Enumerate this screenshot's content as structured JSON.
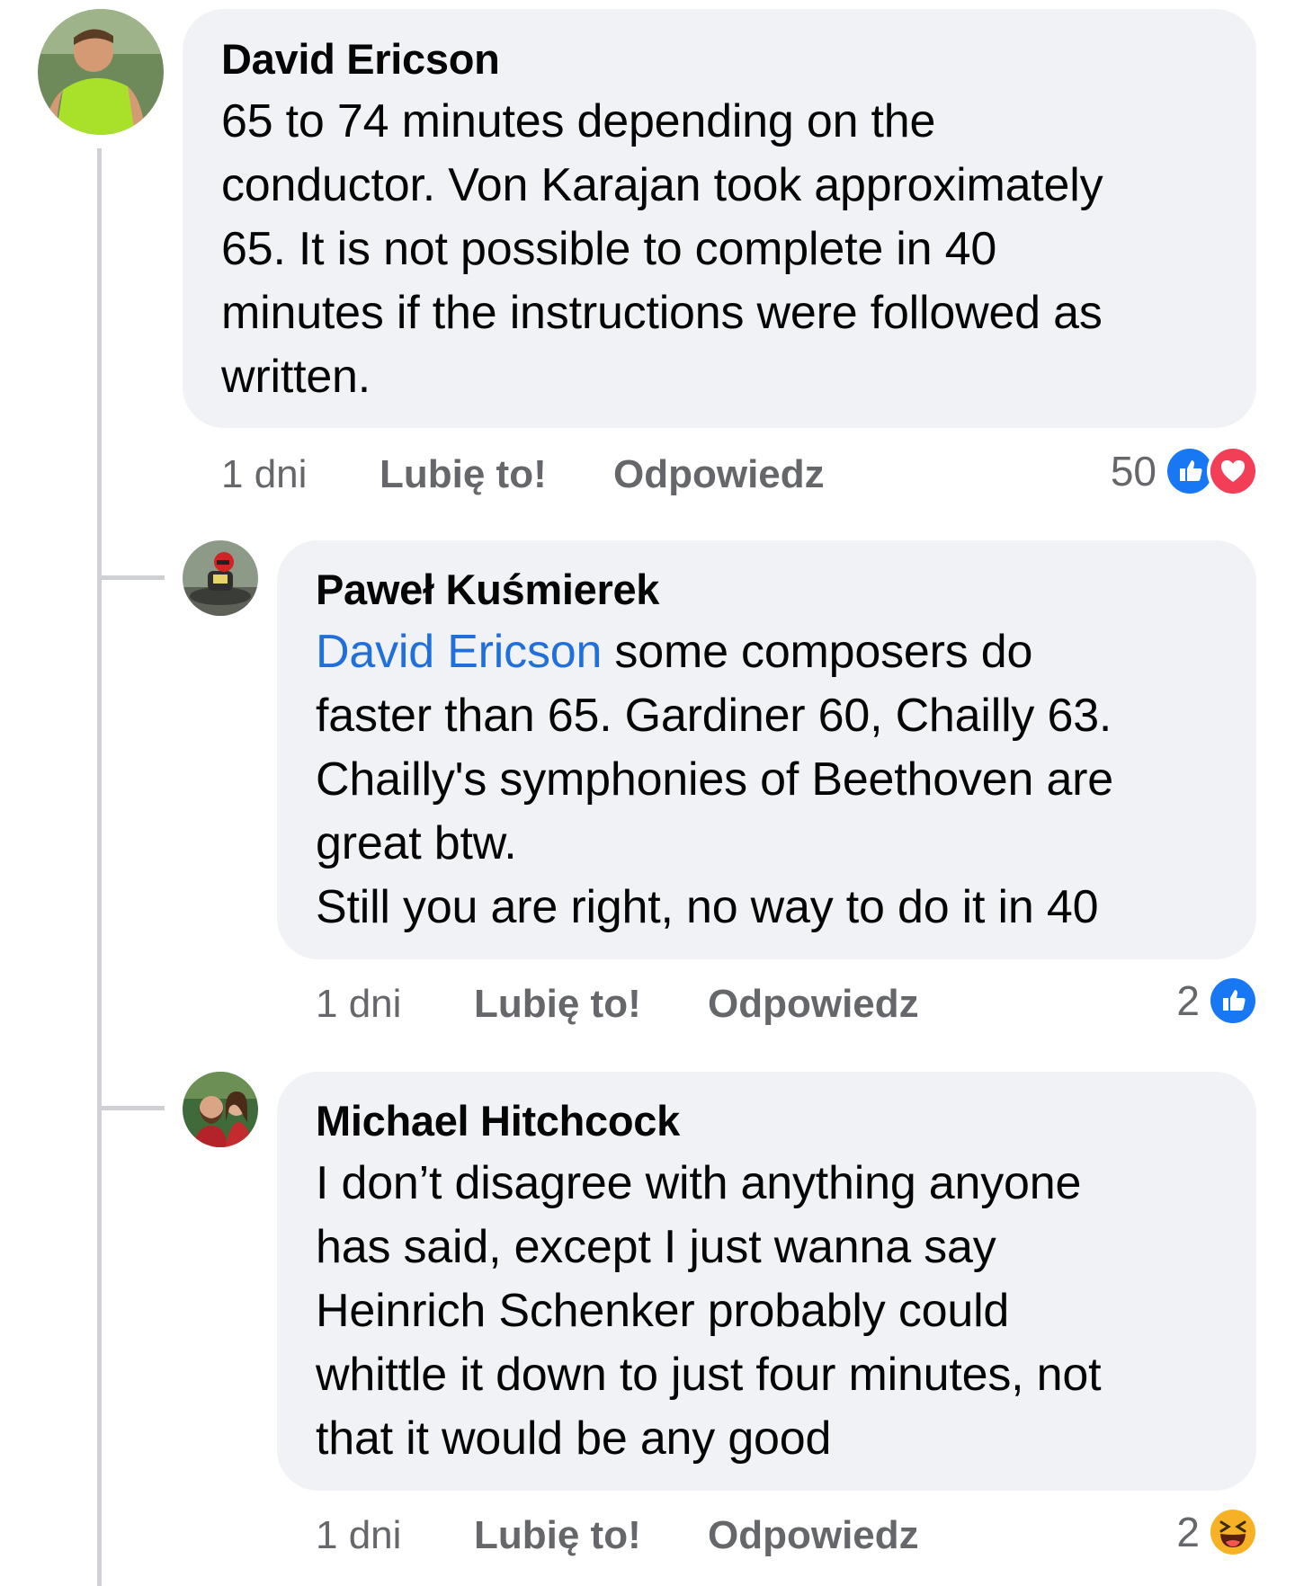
{
  "comments": [
    {
      "author": "David Ericson",
      "lines": [
        "65 to 74 minutes depending on the",
        "conductor. Von Karajan took approximately",
        "65. It is not possible to complete in 40",
        "minutes if the instructions were followed as",
        "written."
      ],
      "time": "1 dni",
      "like_label": "Lubię to!",
      "reply_label": "Odpowiedz",
      "reaction_count": "50",
      "reactions": [
        "like-icon",
        "love-icon"
      ],
      "colors": {
        "like": "#1877f2",
        "love": "#f33e58"
      }
    },
    {
      "author": "Paweł Kuśmierek",
      "mention": "David Ericson",
      "first_line_rest": " some composers do",
      "lines": [
        "faster than 65. Gardiner 60, Chailly 63.",
        "Chailly's symphonies of Beethoven are",
        "great btw.",
        "Still you are right, no way to do it in 40"
      ],
      "time": "1 dni",
      "like_label": "Lubię to!",
      "reply_label": "Odpowiedz",
      "reaction_count": "2",
      "reactions": [
        "like-icon"
      ]
    },
    {
      "author": "Michael Hitchcock",
      "lines": [
        "I don’t disagree with anything anyone",
        "has said, except I just wanna say",
        "Heinrich Schenker probably could",
        "whittle it down to just four minutes, not",
        "that it would be any good"
      ],
      "time": "1 dni",
      "like_label": "Lubię to!",
      "reply_label": "Odpowiedz",
      "reaction_count": "2",
      "reactions": [
        "haha-icon"
      ]
    }
  ]
}
